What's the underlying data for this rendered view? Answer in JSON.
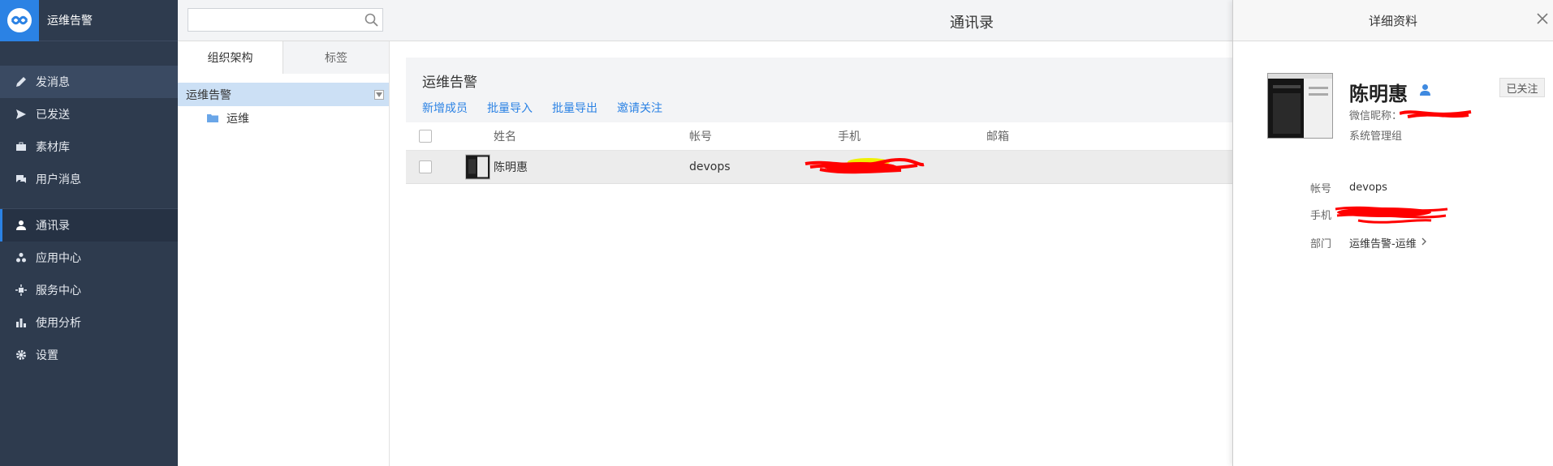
{
  "app": {
    "name": "运维告警"
  },
  "sidebar": {
    "items": [
      {
        "label": "发消息",
        "icon": "pencil-icon"
      },
      {
        "label": "已发送",
        "icon": "send-icon"
      },
      {
        "label": "素材库",
        "icon": "briefcase-icon"
      },
      {
        "label": "用户消息",
        "icon": "chat-icon"
      },
      {
        "label": "通讯录",
        "icon": "person-icon"
      },
      {
        "label": "应用中心",
        "icon": "apps-icon"
      },
      {
        "label": "服务中心",
        "icon": "service-icon"
      },
      {
        "label": "使用分析",
        "icon": "bar-chart-icon"
      },
      {
        "label": "设置",
        "icon": "gear-icon"
      }
    ],
    "active": "通讯录"
  },
  "topbar": {
    "search_placeholder": "",
    "title": "通讯录"
  },
  "tree": {
    "tabs": [
      "组织架构",
      "标签"
    ],
    "root": "运维告警",
    "children": [
      "运维"
    ]
  },
  "main": {
    "group_title": "运维告警",
    "actions": [
      "新增成员",
      "批量导入",
      "批量导出",
      "邀请关注"
    ],
    "columns": [
      "姓名",
      "帐号",
      "手机",
      "邮箱"
    ],
    "rows": [
      {
        "name": "陈明惠",
        "account": "devops",
        "phone": "",
        "email": ""
      }
    ]
  },
  "detail": {
    "title": "详细资料",
    "name": "陈明惠",
    "wx_label": "微信昵称：",
    "group": "系统管理组",
    "follow": "已关注",
    "fields": {
      "account_label": "帐号",
      "account": "devops",
      "phone_label": "手机",
      "phone": "",
      "dept_label": "部门",
      "dept": "运维告警-运维"
    }
  },
  "colors": {
    "accent": "#2b82e4",
    "sidebar_bg": "#2e3b4e",
    "redaction": "#ff0000",
    "highlight": "#f5f500"
  }
}
